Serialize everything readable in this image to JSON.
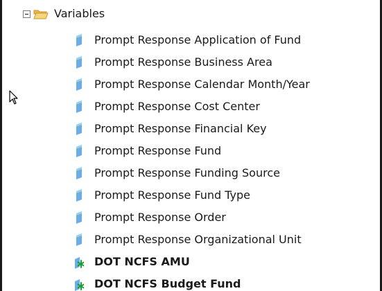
{
  "tree": {
    "root": {
      "label": "Variables",
      "icon": "folder-open-icon",
      "expand_icon": "collapse-minus-icon",
      "expanded": true
    },
    "items": [
      {
        "label": "Prompt Response Application of Fund",
        "icon": "variable-icon",
        "bold": false
      },
      {
        "label": "Prompt Response Business Area",
        "icon": "variable-icon",
        "bold": false
      },
      {
        "label": "Prompt Response Calendar Month/Year",
        "icon": "variable-icon",
        "bold": false
      },
      {
        "label": "Prompt Response Cost Center",
        "icon": "variable-icon",
        "bold": false
      },
      {
        "label": "Prompt Response Financial Key",
        "icon": "variable-icon",
        "bold": false
      },
      {
        "label": "Prompt Response Fund",
        "icon": "variable-icon",
        "bold": false
      },
      {
        "label": "Prompt Response Funding Source",
        "icon": "variable-icon",
        "bold": false
      },
      {
        "label": "Prompt Response Fund Type",
        "icon": "variable-icon",
        "bold": false
      },
      {
        "label": "Prompt Response Order",
        "icon": "variable-icon",
        "bold": false
      },
      {
        "label": "Prompt Response Organizational Unit",
        "icon": "variable-icon",
        "bold": false
      },
      {
        "label": "DOT NCFS AMU",
        "icon": "formula-variable-icon",
        "bold": true
      },
      {
        "label": "DOT NCFS Budget Fund",
        "icon": "formula-variable-icon",
        "bold": true
      }
    ]
  },
  "colors": {
    "variable_icon": "#6aaee6",
    "formula_star": "#1a9e3a",
    "folder": "#f2c65a"
  },
  "cursor": {
    "icon": "mouse-pointer-icon"
  }
}
